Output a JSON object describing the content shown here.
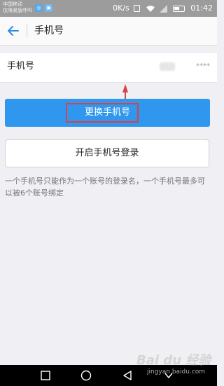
{
  "status_bar": {
    "carrier_line1": "中国移动",
    "carrier_line2": "仅限紧急呼叫",
    "net_speed": "0K/s",
    "time": "01:42"
  },
  "header": {
    "title": "手机号",
    "back_icon": "back-arrow-icon"
  },
  "phone_row": {
    "label": "手机号",
    "value": "****"
  },
  "buttons": {
    "change_phone": "更换手机号",
    "enable_phone_login": "开启手机号登录"
  },
  "note": "一个手机号只能作为一个账号的登录名，一个手机号最多可以被6个账号绑定",
  "watermark": {
    "brand": "Bai du 经验",
    "url": "jingyan.baidu.com"
  },
  "colors": {
    "primary_button": "#2f97ee",
    "highlight": "#d9414b",
    "back_icon": "#2f8de4",
    "status_bar": "#9c9c9c"
  }
}
